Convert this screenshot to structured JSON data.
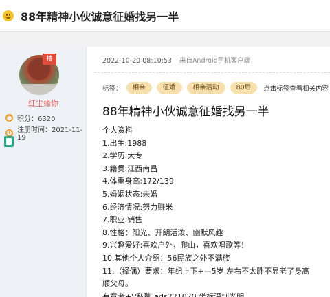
{
  "header": {
    "title": "88年精神小伙诚意征婚找另一半"
  },
  "author": {
    "badge": "楼",
    "username": "红尘缘你",
    "points_label": "积分：6320",
    "registered_label": "注册时间：2021-11-19"
  },
  "post": {
    "datetime": "2022-10-20 08:10:53",
    "client": "来自Android手机客户端",
    "tags_label": "标签：",
    "tags": [
      "相亲",
      "征婚",
      "相亲活动",
      "80后"
    ],
    "tags_hint": "点击标签查看相关内容",
    "title": "88年精神小伙诚意征婚找另一半",
    "lines": [
      "个人资料",
      "1.出生:1988",
      "2.学历:大专",
      "3.籍贯:江西南昌",
      "4.体重身高:172/139",
      "5.婚姻状态:未婚",
      "6.经济情况:努力赚米",
      "7.职业:销售",
      "8.性格：阳光、开朗活泼、幽默风趣",
      "9.兴趣爱好:喜欢户外，爬山，喜欢唱歌等！",
      "10.其他个人介绍：56民族之外不满族",
      "11.（择偶）要求：年纪上下+—5岁 左右不太胖不显老了身高",
      "顺父母。",
      "有意者+V私聊 ads221020 坐标深圳光明"
    ]
  }
}
